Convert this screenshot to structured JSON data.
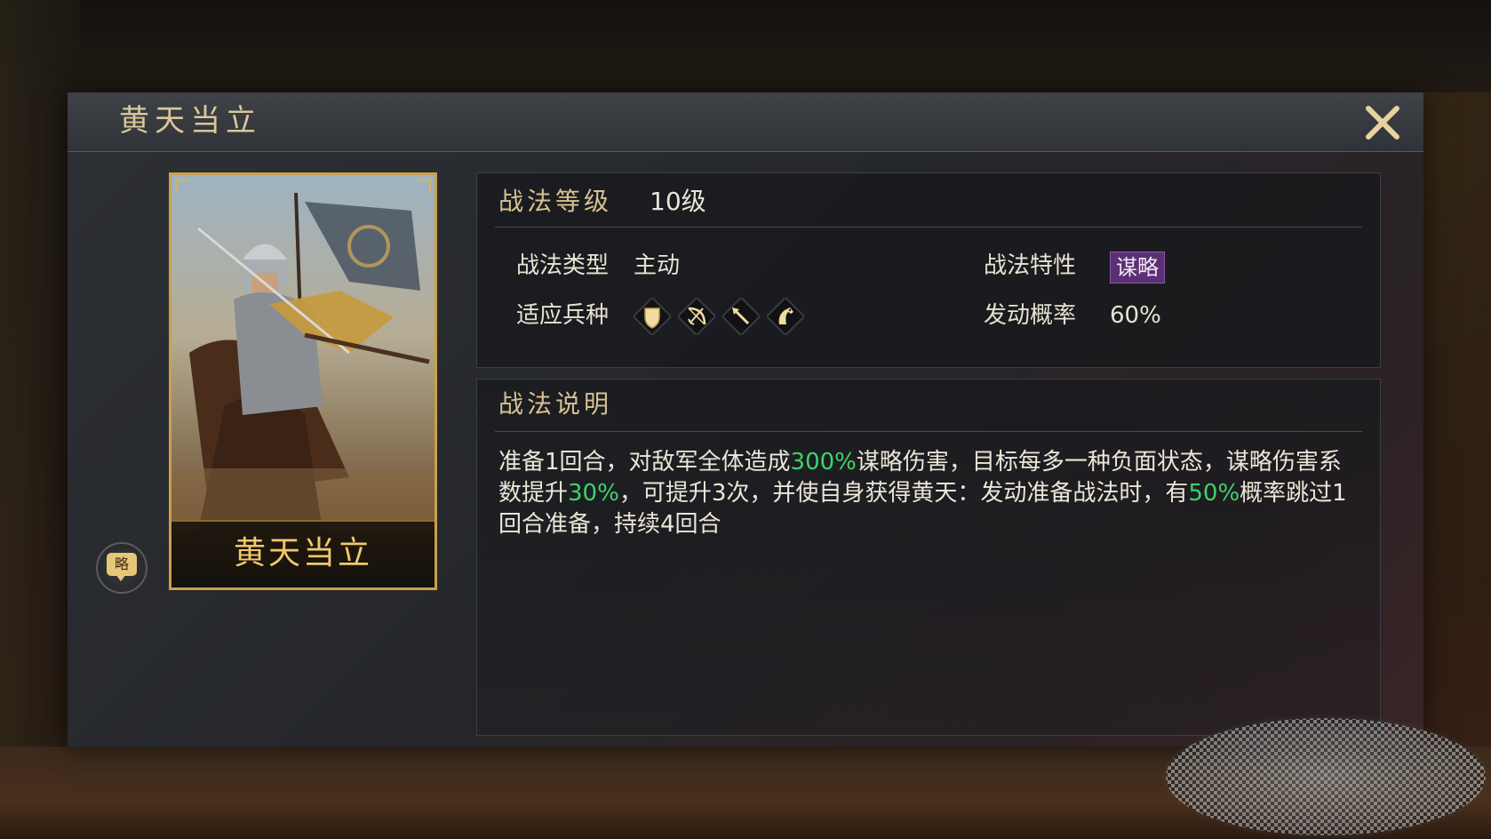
{
  "window": {
    "title": "黄天当立"
  },
  "card": {
    "name": "黄天当立"
  },
  "tag": {
    "label": "略"
  },
  "info": {
    "level_label": "战法等级",
    "level_value": "10级",
    "type_label": "战法类型",
    "type_value": "主动",
    "units_label": "适应兵种",
    "units": [
      {
        "icon": "shield-icon",
        "kind": "盾兵"
      },
      {
        "icon": "bow-icon",
        "kind": "弓兵"
      },
      {
        "icon": "spear-icon",
        "kind": "枪兵"
      },
      {
        "icon": "horse-icon",
        "kind": "骑兵"
      }
    ],
    "trait_label": "战法特性",
    "trait_value": "谋略",
    "rate_label": "发动概率",
    "rate_value": "60%"
  },
  "description": {
    "heading": "战法说明",
    "segments": [
      {
        "text": "准备1回合，对敌军全体造成",
        "highlight": false
      },
      {
        "text": "300%",
        "highlight": true
      },
      {
        "text": "谋略伤害，目标每多一种负面状态，谋略伤害系数提升",
        "highlight": false
      },
      {
        "text": "30%",
        "highlight": true
      },
      {
        "text": "，可提升3次，并使自身获得黄天：发动准备战法时，有",
        "highlight": false
      },
      {
        "text": "50%",
        "highlight": true
      },
      {
        "text": "概率跳过1回合准备，持续4回合",
        "highlight": false
      }
    ]
  },
  "colors": {
    "gold": "#d9c79a",
    "highlight_green": "#3fd26a",
    "trait_purple": "#5b2f74",
    "card_border": "#c9a04c"
  }
}
